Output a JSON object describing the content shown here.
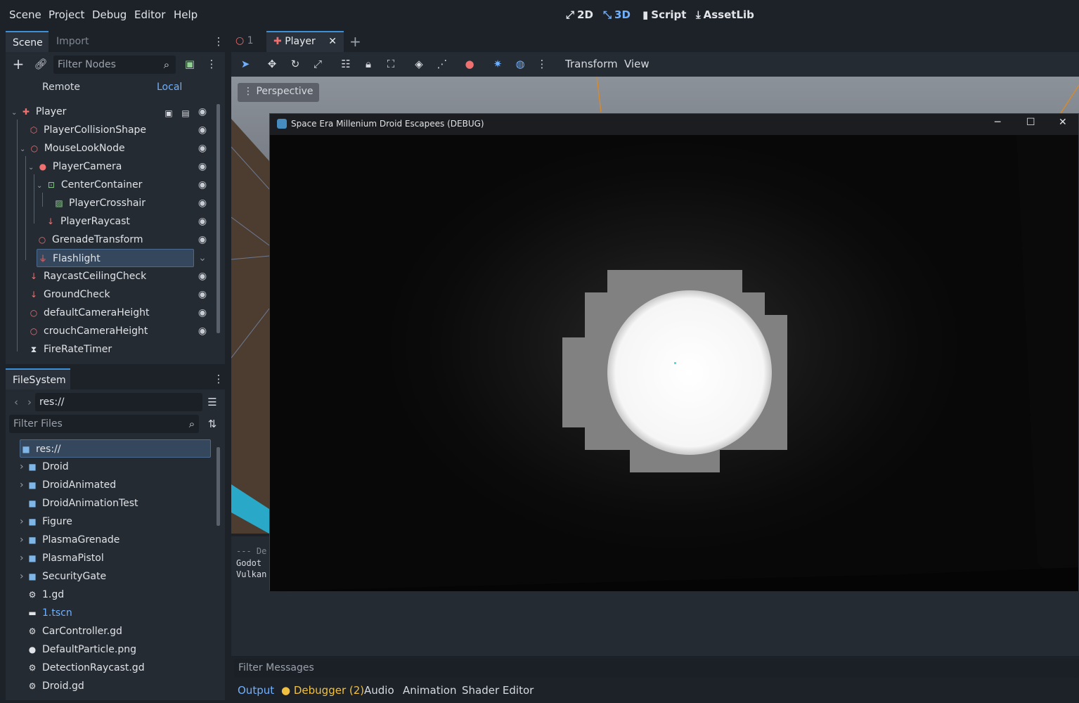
{
  "menu": [
    "Scene",
    "Project",
    "Debug",
    "Editor",
    "Help"
  ],
  "main_tabs": {
    "d2": "2D",
    "d3": "3D",
    "script": "Script",
    "assetlib": "AssetLib"
  },
  "scene_dock": {
    "tabs": {
      "scene": "Scene",
      "import": "Import"
    },
    "filter_placeholder": "Filter Nodes",
    "remote": "Remote",
    "local": "Local",
    "nodes": [
      {
        "label": "Player",
        "icon": "player-node-icon",
        "depth": 0,
        "color": "#f07070"
      },
      {
        "label": "PlayerCollisionShape",
        "icon": "collision-shape-icon",
        "depth": 1
      },
      {
        "label": "MouseLookNode",
        "icon": "node3d-icon",
        "depth": 1
      },
      {
        "label": "PlayerCamera",
        "icon": "camera-icon",
        "depth": 2
      },
      {
        "label": "CenterContainer",
        "icon": "center-container-icon",
        "depth": 3
      },
      {
        "label": "PlayerCrosshair",
        "icon": "texture-rect-icon",
        "depth": 4
      },
      {
        "label": "PlayerRaycast",
        "icon": "raycast-icon",
        "depth": 3
      },
      {
        "label": "GrenadeTransform",
        "icon": "node3d-icon",
        "depth": 2
      },
      {
        "label": "Flashlight",
        "icon": "spotlight-icon",
        "depth": 2
      },
      {
        "label": "RaycastCeilingCheck",
        "icon": "raycast-icon",
        "depth": 1
      },
      {
        "label": "GroundCheck",
        "icon": "raycast-icon",
        "depth": 1
      },
      {
        "label": "defaultCameraHeight",
        "icon": "node3d-icon",
        "depth": 1
      },
      {
        "label": "crouchCameraHeight",
        "icon": "node3d-icon",
        "depth": 1
      },
      {
        "label": "FireRateTimer",
        "icon": "timer-icon",
        "depth": 1
      }
    ]
  },
  "filesystem": {
    "tab": "FileSystem",
    "path": "res://",
    "filter_placeholder": "Filter Files",
    "items": [
      {
        "label": "res://",
        "type": "folder",
        "depth": 0
      },
      {
        "label": "Droid",
        "type": "folder",
        "depth": 1
      },
      {
        "label": "DroidAnimated",
        "type": "folder",
        "depth": 1
      },
      {
        "label": "DroidAnimationTest",
        "type": "folder",
        "depth": 1
      },
      {
        "label": "Figure",
        "type": "folder",
        "depth": 1
      },
      {
        "label": "PlasmaGrenade",
        "type": "folder",
        "depth": 1
      },
      {
        "label": "PlasmaPistol",
        "type": "folder",
        "depth": 1
      },
      {
        "label": "SecurityGate",
        "type": "folder",
        "depth": 1
      },
      {
        "label": "1.gd",
        "type": "script",
        "depth": 1
      },
      {
        "label": "1.tscn",
        "type": "scene",
        "depth": 1
      },
      {
        "label": "CarController.gd",
        "type": "script",
        "depth": 1
      },
      {
        "label": "DefaultParticle.png",
        "type": "image",
        "depth": 1
      },
      {
        "label": "DetectionRaycast.gd",
        "type": "script",
        "depth": 1
      },
      {
        "label": "Droid.gd",
        "type": "script",
        "depth": 1
      }
    ]
  },
  "editor_tabs": {
    "tab1": "1",
    "tab2": "Player"
  },
  "toolbar": {
    "transform": "Transform",
    "view": "View"
  },
  "viewport": {
    "perspective": "Perspective"
  },
  "game_window": {
    "title": "Space Era Millenium Droid Escapees (DEBUG)"
  },
  "output": {
    "lines": [
      "--- De",
      "Godot",
      "Vulkan"
    ],
    "filter_placeholder": "Filter Messages"
  },
  "bottom_tabs": {
    "output": "Output",
    "debugger": "Debugger (2)",
    "audio": "Audio",
    "animation": "Animation",
    "shader": "Shader Editor"
  }
}
